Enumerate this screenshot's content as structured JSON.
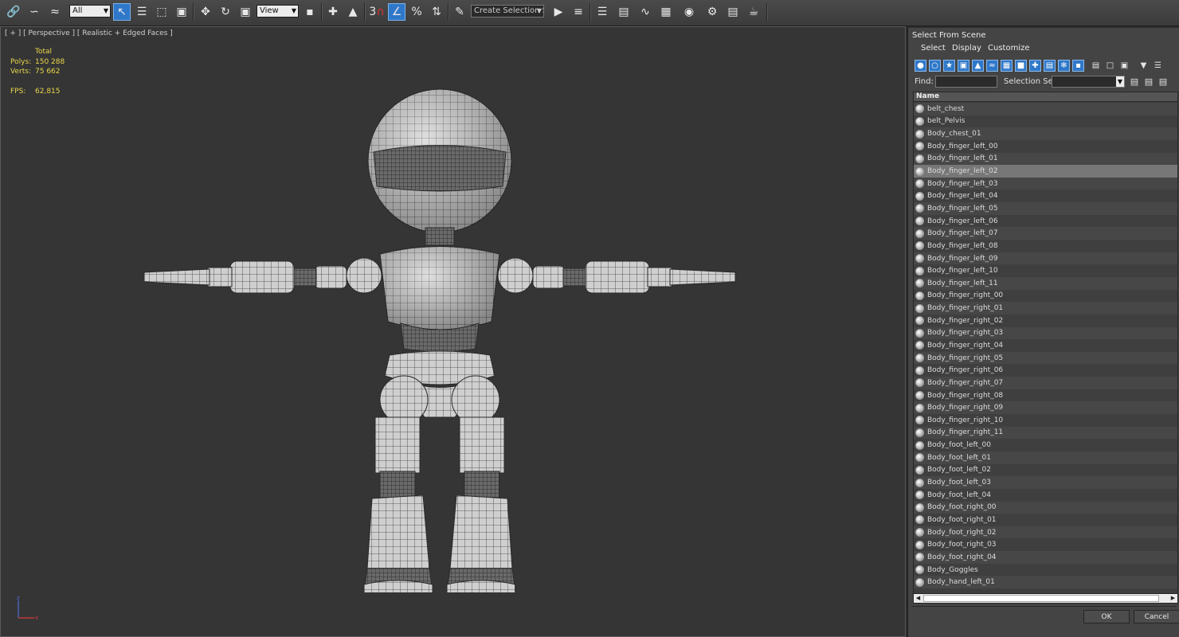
{
  "toolbar": {
    "filter_value": "All",
    "view_value": "View",
    "snap_label": "3",
    "angle_snap_label": "∠",
    "percent_snap_label": "%",
    "selection_set_value": "Create Selection Se",
    "icons": [
      "link-icon",
      "unlink-icon",
      "bind-space-warp-icon",
      "select-object-icon",
      "select-by-name-icon",
      "rect-selection-icon",
      "window-crossing-icon",
      "move-icon",
      "rotate-icon",
      "scale-icon",
      "pivot-icon",
      "manipulate-icon",
      "keyboard-shortcut-icon",
      "snap-toggle-icon",
      "angle-snap-icon",
      "percent-snap-icon",
      "spinner-snap-icon",
      "edit-named-selection-icon",
      "mirror-icon",
      "align-icon",
      "layer-explorer-icon",
      "scene-explorer-icon",
      "curve-editor-icon",
      "schematic-view-icon",
      "material-editor-icon",
      "render-setup-icon",
      "rendered-frame-icon",
      "render-icon"
    ]
  },
  "viewport": {
    "label": "[ + ] [ Perspective ] [ Realistic + Edged Faces ]",
    "stats": {
      "total_label": "Total",
      "polys_label": "Polys:",
      "polys_value": "150 288",
      "verts_label": "Verts:",
      "verts_value": "75 662",
      "fps_label": "FPS:",
      "fps_value": "62,815"
    },
    "stats_color": "#e9d64a",
    "axis": {
      "z": "z",
      "x": "x"
    }
  },
  "dialog": {
    "title": "Select From Scene",
    "menu": [
      "Select",
      "Display",
      "Customize"
    ],
    "find_label": "Find:",
    "find_value": "",
    "selection_set_label": "Selection Set:",
    "selection_set_value": "",
    "column_header": "Name",
    "selected_item": "Body_finger_left_02",
    "items": [
      "belt_chest",
      "belt_Pelvis",
      "Body_chest_01",
      "Body_finger_left_00",
      "Body_finger_left_01",
      "Body_finger_left_02",
      "Body_finger_left_03",
      "Body_finger_left_04",
      "Body_finger_left_05",
      "Body_finger_left_06",
      "Body_finger_left_07",
      "Body_finger_left_08",
      "Body_finger_left_09",
      "Body_finger_left_10",
      "Body_finger_left_11",
      "Body_finger_right_00",
      "Body_finger_right_01",
      "Body_finger_right_02",
      "Body_finger_right_03",
      "Body_finger_right_04",
      "Body_finger_right_05",
      "Body_finger_right_06",
      "Body_finger_right_07",
      "Body_finger_right_08",
      "Body_finger_right_09",
      "Body_finger_right_10",
      "Body_finger_right_11",
      "Body_foot_left_00",
      "Body_foot_left_01",
      "Body_foot_left_02",
      "Body_foot_left_03",
      "Body_foot_left_04",
      "Body_foot_right_00",
      "Body_foot_right_01",
      "Body_foot_right_02",
      "Body_foot_right_03",
      "Body_foot_right_04",
      "Body_Goggles",
      "Body_hand_left_01"
    ],
    "ok_label": "OK",
    "cancel_label": "Cancel",
    "accent": "#2f78c9"
  }
}
